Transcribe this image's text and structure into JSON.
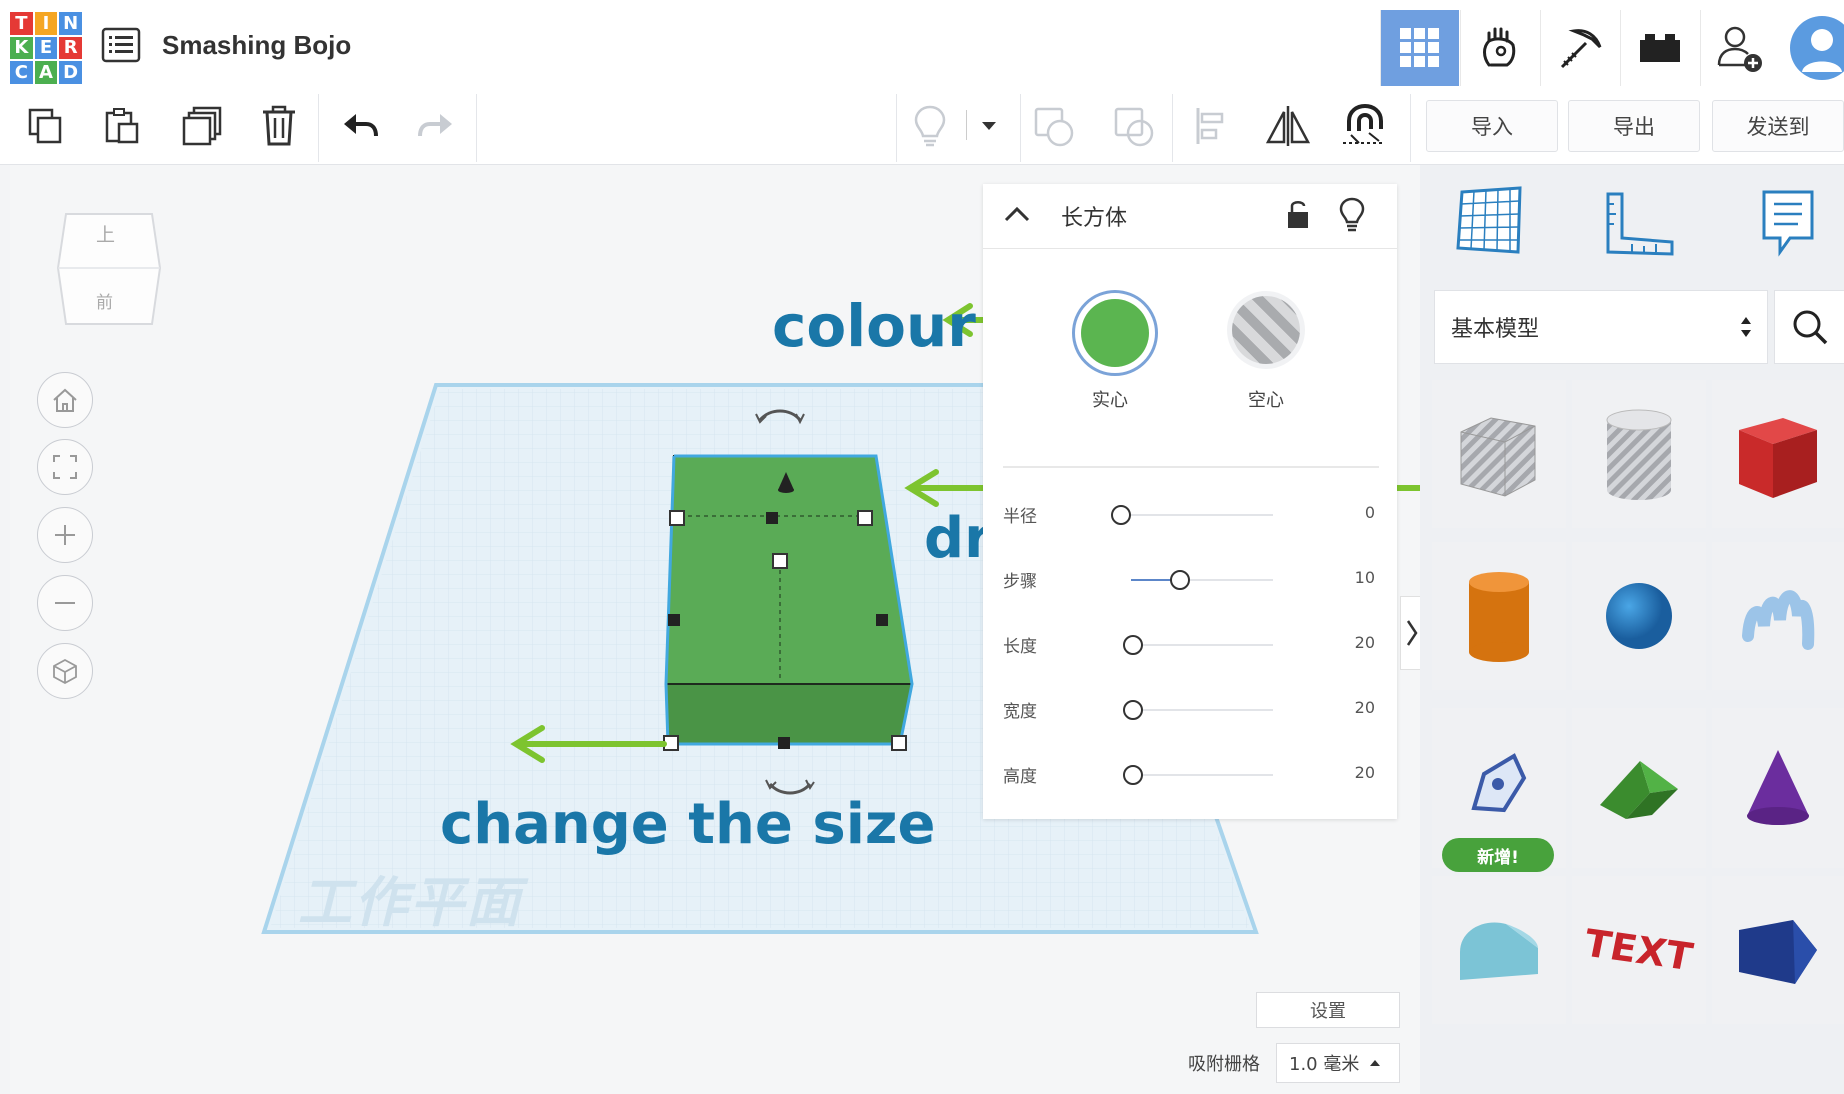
{
  "app": {
    "logo_letters": [
      "T",
      "I",
      "N",
      "K",
      "E",
      "R",
      "C",
      "A",
      "D"
    ],
    "logo_colors": [
      "#e53935",
      "#f5a623",
      "#4a90e2",
      "#4caf50",
      "#4a90e2",
      "#e53935",
      "#4a90e2",
      "#4caf50",
      "#4a90e2"
    ],
    "title": "Smashing Bojo"
  },
  "header": {
    "view_buttons": [
      {
        "icon": "grid-view-icon",
        "active": true
      },
      {
        "icon": "hand-icon",
        "active": false
      },
      {
        "icon": "pickaxe-icon",
        "active": false
      },
      {
        "icon": "brick-icon",
        "active": false
      },
      {
        "icon": "add-user-icon",
        "active": false
      },
      {
        "icon": "avatar-icon",
        "active": false
      }
    ]
  },
  "toolbar": {
    "left_icons": [
      "copy-icon",
      "paste-icon",
      "duplicate-icon",
      "delete-icon",
      "undo-icon",
      "redo-icon"
    ],
    "mid_icons": [
      "lightbulb-icon",
      "dropdown-caret-icon",
      "group-icon",
      "ungroup-icon",
      "align-icon",
      "mirror-icon",
      "magnet-icon"
    ],
    "import_label": "导入",
    "export_label": "导出",
    "send_label": "发送到"
  },
  "viewcube": {
    "top": "上",
    "front": "前"
  },
  "workplane": {
    "label": "工作平面"
  },
  "annotations": {
    "colour": "colour",
    "drag_in": "drag in",
    "change_size": "change the size"
  },
  "inspector": {
    "shape_name": "长方体",
    "solid_label": "实心",
    "hole_label": "空心",
    "solid_color": "#5bb550",
    "params": [
      {
        "label": "半径",
        "value": "0",
        "fraction": 0.0
      },
      {
        "label": "步骤",
        "value": "10",
        "fraction": 0.38
      },
      {
        "label": "长度",
        "value": "20",
        "fraction": 0.08
      },
      {
        "label": "宽度",
        "value": "20",
        "fraction": 0.08
      },
      {
        "label": "高度",
        "value": "20",
        "fraction": 0.08
      }
    ]
  },
  "right_panel": {
    "category": "基本模型",
    "new_badge": "新增!",
    "top_icons": [
      "workplane-grid-icon",
      "ruler-icon",
      "notes-icon"
    ],
    "shapes": [
      "box-hole",
      "cylinder-hole",
      "box",
      "cylinder",
      "sphere",
      "scribble",
      "text-shape",
      "roof",
      "cone",
      "half-cylinder",
      "text-3d",
      "wedge"
    ],
    "text_shape_label": "TEXT"
  },
  "bottom": {
    "settings_label": "设置",
    "snap_label": "吸附栅格",
    "snap_value": "1.0 毫米"
  }
}
